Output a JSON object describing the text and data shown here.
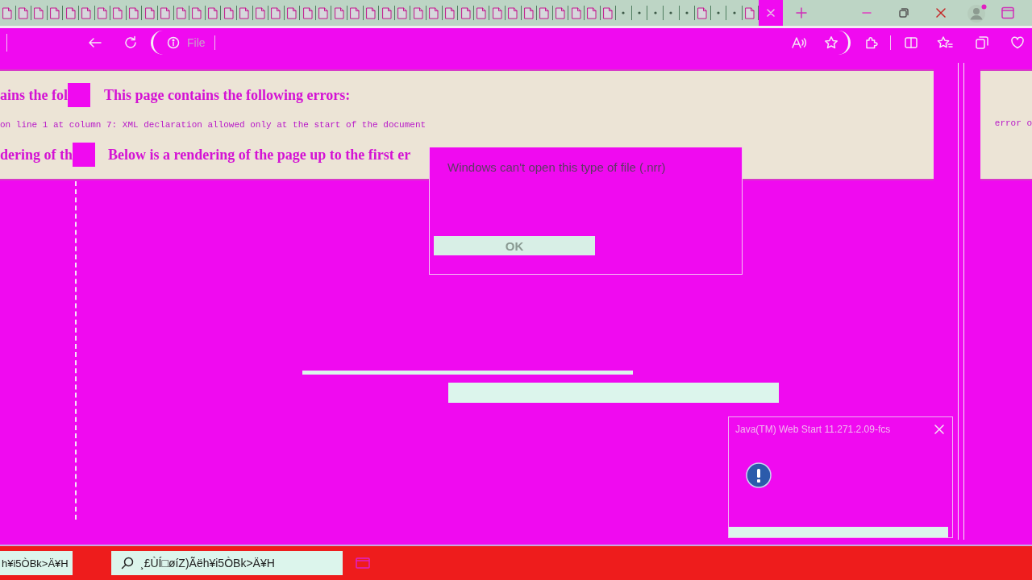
{
  "tabs": [
    {
      "kind": "page",
      "selected": false
    },
    {
      "kind": "page",
      "selected": false
    },
    {
      "kind": "page",
      "selected": false
    },
    {
      "kind": "page",
      "selected": false
    },
    {
      "kind": "page",
      "selected": false
    },
    {
      "kind": "page",
      "selected": false
    },
    {
      "kind": "page",
      "selected": false
    },
    {
      "kind": "page",
      "selected": false
    },
    {
      "kind": "page",
      "selected": false
    },
    {
      "kind": "page",
      "selected": false
    },
    {
      "kind": "page",
      "selected": false
    },
    {
      "kind": "page",
      "selected": false
    },
    {
      "kind": "page",
      "selected": false
    },
    {
      "kind": "page",
      "selected": false
    },
    {
      "kind": "page",
      "selected": false
    },
    {
      "kind": "page",
      "selected": false
    },
    {
      "kind": "page",
      "selected": false
    },
    {
      "kind": "page",
      "selected": false
    },
    {
      "kind": "page",
      "selected": false
    },
    {
      "kind": "page",
      "selected": false
    },
    {
      "kind": "page",
      "selected": false
    },
    {
      "kind": "page",
      "selected": false
    },
    {
      "kind": "page",
      "selected": false
    },
    {
      "kind": "page",
      "selected": false
    },
    {
      "kind": "page",
      "selected": false
    },
    {
      "kind": "page",
      "selected": false
    },
    {
      "kind": "page",
      "selected": false
    },
    {
      "kind": "page",
      "selected": false
    },
    {
      "kind": "page",
      "selected": false
    },
    {
      "kind": "page",
      "selected": false
    },
    {
      "kind": "page",
      "selected": false
    },
    {
      "kind": "page",
      "selected": false
    },
    {
      "kind": "page",
      "selected": false
    },
    {
      "kind": "page",
      "selected": false
    },
    {
      "kind": "page",
      "selected": false
    },
    {
      "kind": "page",
      "selected": false
    },
    {
      "kind": "page",
      "selected": false
    },
    {
      "kind": "page",
      "selected": false
    },
    {
      "kind": "page",
      "selected": false
    },
    {
      "kind": "dot",
      "selected": false
    },
    {
      "kind": "dot",
      "selected": false
    },
    {
      "kind": "dot",
      "selected": false
    },
    {
      "kind": "dot",
      "selected": false
    },
    {
      "kind": "dot",
      "selected": false
    },
    {
      "kind": "page",
      "selected": false
    },
    {
      "kind": "dot",
      "selected": false
    },
    {
      "kind": "dot",
      "selected": false
    },
    {
      "kind": "page",
      "selected": false
    },
    {
      "kind": "blank",
      "selected": true
    }
  ],
  "address_bar": {
    "label": "File"
  },
  "error_page": {
    "heading_fragment": "ains the fol",
    "heading": "This page contains the following errors:",
    "error_line": "on line 1 at column 7: XML declaration allowed only at the start of the document",
    "caption_fragment": "dering of th",
    "caption": "Below is a rendering of the page up to the first er",
    "side_fragment": "error o"
  },
  "dialog": {
    "message": "Windows can't open this type of file (.nrr)",
    "buttons": [
      "OK"
    ]
  },
  "notification": {
    "title": "Java(TM) Web Start 11.271.2.09-fcs"
  },
  "taskbar": {
    "window_label": "h¥i5ÒBk>Ä¥H",
    "search": {
      "placeholder": "¸£ÙÍ□øíZ)Ãëh¥i5ÒBk>Ä¥H"
    }
  }
}
